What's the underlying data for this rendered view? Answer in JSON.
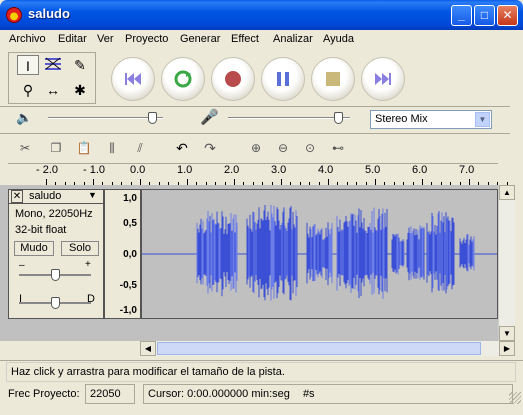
{
  "window": {
    "title": "saludo"
  },
  "menu": [
    "Archivo",
    "Editar",
    "Ver",
    "Proyecto",
    "Generar",
    "Effect",
    "Analizar",
    "Ayuda"
  ],
  "mixer": {
    "input_source": "Stereo Mix",
    "output_volume": 0.9,
    "input_volume": 0.9
  },
  "ruler": {
    "labels": [
      "- 2.0",
      "- 1.0",
      "0.0",
      "1.0",
      "2.0",
      "3.0",
      "4.0",
      "5.0",
      "6.0",
      "7.0"
    ]
  },
  "track": {
    "name": "saludo",
    "info_line1": "Mono, 22050Hz",
    "info_line2": "32-bit float",
    "mute_label": "Mudo",
    "solo_label": "Solo",
    "gain_minus": "–",
    "gain_plus": "+",
    "pan_left": "I",
    "pan_right": "D",
    "gain_value": 0.5,
    "pan_value": 0.5,
    "y_labels": [
      "1,0",
      "0,5",
      "0,0",
      "-0,5",
      "-1,0"
    ]
  },
  "status": {
    "message": "Haz click y arrastra para modificar el tamaño de la pista.",
    "rate_label": "Frec Proyecto:",
    "rate_value": "22050",
    "cursor_text": "Cursor: 0:00.000000 min:seg",
    "cursor_suffix": "#s"
  },
  "colors": {
    "waveform": "#3a4fd6",
    "waveform_light": "#6b7de8",
    "track_bg": "#c0c0c0"
  }
}
